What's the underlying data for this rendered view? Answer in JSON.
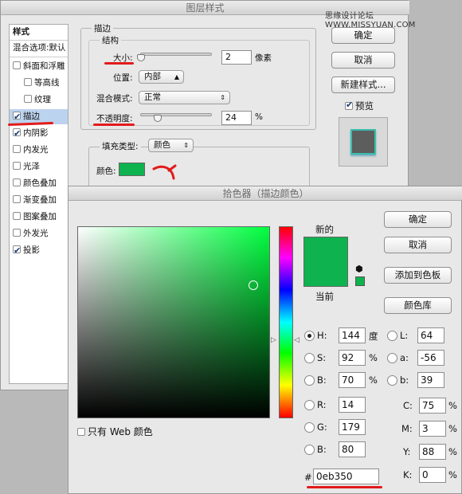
{
  "layer_style": {
    "title": "图层样式",
    "watermark": "思缘设计论坛 WWW.MISSYUAN.COM",
    "sidebar": {
      "items": [
        {
          "label": "样式",
          "checkbox": null
        },
        {
          "label": "混合选项:默认",
          "checkbox": null
        },
        {
          "label": "斜面和浮雕",
          "checkbox": false
        },
        {
          "label": "等高线",
          "checkbox": false
        },
        {
          "label": "纹理",
          "checkbox": false
        },
        {
          "label": "描边",
          "checkbox": true
        },
        {
          "label": "内阴影",
          "checkbox": true
        },
        {
          "label": "内发光",
          "checkbox": false
        },
        {
          "label": "光泽",
          "checkbox": false
        },
        {
          "label": "颜色叠加",
          "checkbox": false
        },
        {
          "label": "渐变叠加",
          "checkbox": false
        },
        {
          "label": "图案叠加",
          "checkbox": false
        },
        {
          "label": "外发光",
          "checkbox": false
        },
        {
          "label": "投影",
          "checkbox": true
        }
      ]
    },
    "stroke": {
      "group_label": "描边",
      "structure_label": "结构",
      "size_label": "大小:",
      "size_value": "2",
      "size_unit": "像素",
      "position_label": "位置:",
      "position_value": "内部",
      "blend_label": "混合模式:",
      "blend_value": "正常",
      "opacity_label": "不透明度:",
      "opacity_value": "24",
      "opacity_unit": "%",
      "fill_type_label": "填充类型:",
      "fill_type_value": "颜色",
      "color_label": "颜色:",
      "color": "#0eb350"
    },
    "buttons": {
      "ok": "确定",
      "cancel": "取消",
      "new_style": "新建样式...",
      "preview": "预览"
    },
    "preview_checked": true
  },
  "color_picker": {
    "title": "拾色器（描边颜色）",
    "new_label": "新的",
    "current_label": "当前",
    "new_color": "#0eb350",
    "current_color": "#0eb350",
    "buttons": {
      "ok": "确定",
      "cancel": "取消",
      "add_swatch": "添加到色板",
      "libraries": "颜色库"
    },
    "web_only_label": "只有 Web 颜色",
    "fields": {
      "H": {
        "label": "H:",
        "value": "144",
        "unit": "度"
      },
      "S": {
        "label": "S:",
        "value": "92",
        "unit": "%"
      },
      "B": {
        "label": "B:",
        "value": "70",
        "unit": "%"
      },
      "R": {
        "label": "R:",
        "value": "14"
      },
      "G": {
        "label": "G:",
        "value": "179"
      },
      "Bl": {
        "label": "B:",
        "value": "80"
      },
      "L": {
        "label": "L:",
        "value": "64"
      },
      "a": {
        "label": "a:",
        "value": "-56"
      },
      "b": {
        "label": "b:",
        "value": "39"
      },
      "C": {
        "label": "C:",
        "value": "75",
        "unit": "%"
      },
      "M": {
        "label": "M:",
        "value": "3",
        "unit": "%"
      },
      "Y": {
        "label": "Y:",
        "value": "88",
        "unit": "%"
      },
      "K": {
        "label": "K:",
        "value": "0",
        "unit": "%"
      }
    },
    "hex_label": "#",
    "hex_value": "0eb350"
  }
}
